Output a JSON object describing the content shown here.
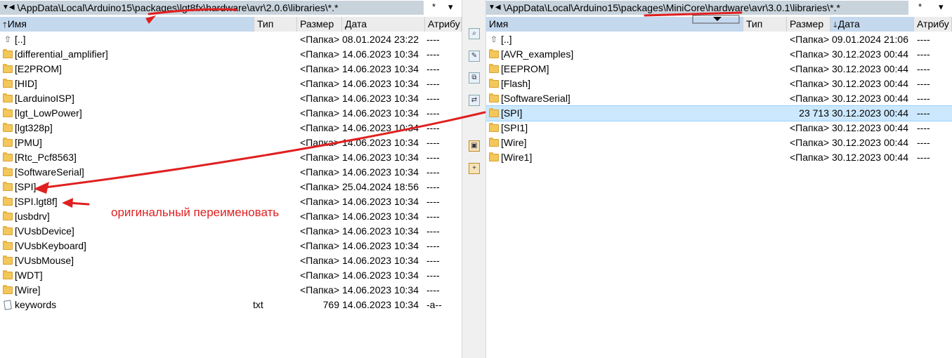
{
  "left_panel": {
    "path": "\\AppData\\Local\\Arduino15\\packages\\lgt8fx\\hardware\\avr\\2.0.6\\libraries\\*.*",
    "filter": "*",
    "filter_arrow": "▾",
    "columns": {
      "name": "Имя",
      "ext": "Тип",
      "size": "Размер",
      "date": "Дата",
      "attr": "Атрибу"
    },
    "rows": [
      {
        "icon": "up",
        "name": "[..]",
        "ext": "",
        "size": "<Папка>",
        "date": "08.01.2024 23:22",
        "attr": "----"
      },
      {
        "icon": "folder",
        "name": "[differential_amplifier]",
        "ext": "",
        "size": "<Папка>",
        "date": "14.06.2023 10:34",
        "attr": "----"
      },
      {
        "icon": "folder",
        "name": "[E2PROM]",
        "ext": "",
        "size": "<Папка>",
        "date": "14.06.2023 10:34",
        "attr": "----"
      },
      {
        "icon": "folder",
        "name": "[HID]",
        "ext": "",
        "size": "<Папка>",
        "date": "14.06.2023 10:34",
        "attr": "----"
      },
      {
        "icon": "folder",
        "name": "[LarduinoISP]",
        "ext": "",
        "size": "<Папка>",
        "date": "14.06.2023 10:34",
        "attr": "----"
      },
      {
        "icon": "folder",
        "name": "[lgt_LowPower]",
        "ext": "",
        "size": "<Папка>",
        "date": "14.06.2023 10:34",
        "attr": "----"
      },
      {
        "icon": "folder",
        "name": "[lgt328p]",
        "ext": "",
        "size": "<Папка>",
        "date": "14.06.2023 10:34",
        "attr": "----"
      },
      {
        "icon": "folder",
        "name": "[PMU]",
        "ext": "",
        "size": "<Папка>",
        "date": "14.06.2023 10:34",
        "attr": "----"
      },
      {
        "icon": "folder",
        "name": "[Rtc_Pcf8563]",
        "ext": "",
        "size": "<Папка>",
        "date": "14.06.2023 10:34",
        "attr": "----"
      },
      {
        "icon": "folder",
        "name": "[SoftwareSerial]",
        "ext": "",
        "size": "<Папка>",
        "date": "14.06.2023 10:34",
        "attr": "----"
      },
      {
        "icon": "folder",
        "name": "[SPI]",
        "ext": "",
        "size": "<Папка>",
        "date": "25.04.2024 18:56",
        "attr": "----"
      },
      {
        "icon": "folder",
        "name": "[SPI.lgt8f]",
        "ext": "",
        "size": "<Папка>",
        "date": "14.06.2023 10:34",
        "attr": "----"
      },
      {
        "icon": "folder",
        "name": "[usbdrv]",
        "ext": "",
        "size": "<Папка>",
        "date": "14.06.2023 10:34",
        "attr": "----"
      },
      {
        "icon": "folder",
        "name": "[VUsbDevice]",
        "ext": "",
        "size": "<Папка>",
        "date": "14.06.2023 10:34",
        "attr": "----"
      },
      {
        "icon": "folder",
        "name": "[VUsbKeyboard]",
        "ext": "",
        "size": "<Папка>",
        "date": "14.06.2023 10:34",
        "attr": "----"
      },
      {
        "icon": "folder",
        "name": "[VUsbMouse]",
        "ext": "",
        "size": "<Папка>",
        "date": "14.06.2023 10:34",
        "attr": "----"
      },
      {
        "icon": "folder",
        "name": "[WDT]",
        "ext": "",
        "size": "<Папка>",
        "date": "14.06.2023 10:34",
        "attr": "----"
      },
      {
        "icon": "folder",
        "name": "[Wire]",
        "ext": "",
        "size": "<Папка>",
        "date": "14.06.2023 10:34",
        "attr": "----"
      },
      {
        "icon": "file",
        "name": "keywords",
        "ext": "txt",
        "size": "769",
        "date": "14.06.2023 10:34",
        "attr": "-a--"
      }
    ]
  },
  "right_panel": {
    "path": "\\AppData\\Local\\Arduino15\\packages\\MiniCore\\hardware\\avr\\3.0.1\\libraries\\*.*",
    "filter": "*",
    "filter_arrow": "▾",
    "columns": {
      "name": "Имя",
      "ext": "Тип",
      "size": "Размер",
      "date": "Дата",
      "attr": "Атрибу"
    },
    "rows": [
      {
        "icon": "up",
        "name": "[..]",
        "ext": "",
        "size": "<Папка>",
        "date": "09.01.2024 21:06",
        "attr": "----"
      },
      {
        "icon": "folder",
        "name": "[AVR_examples]",
        "ext": "",
        "size": "<Папка>",
        "date": "30.12.2023 00:44",
        "attr": "----"
      },
      {
        "icon": "folder",
        "name": "[EEPROM]",
        "ext": "",
        "size": "<Папка>",
        "date": "30.12.2023 00:44",
        "attr": "----"
      },
      {
        "icon": "folder",
        "name": "[Flash]",
        "ext": "",
        "size": "<Папка>",
        "date": "30.12.2023 00:44",
        "attr": "----"
      },
      {
        "icon": "folder",
        "name": "[SoftwareSerial]",
        "ext": "",
        "size": "<Папка>",
        "date": "30.12.2023 00:44",
        "attr": "----"
      },
      {
        "icon": "folder",
        "name": "[SPI]",
        "ext": "",
        "size": "23 713",
        "date": "30.12.2023 00:44",
        "attr": "----",
        "selected": true
      },
      {
        "icon": "folder",
        "name": "[SPI1]",
        "ext": "",
        "size": "<Папка>",
        "date": "30.12.2023 00:44",
        "attr": "----"
      },
      {
        "icon": "folder",
        "name": "[Wire]",
        "ext": "",
        "size": "<Папка>",
        "date": "30.12.2023 00:44",
        "attr": "----"
      },
      {
        "icon": "folder",
        "name": "[Wire1]",
        "ext": "",
        "size": "<Папка>",
        "date": "30.12.2023 00:44",
        "attr": "----"
      }
    ]
  },
  "annotation": {
    "text": "оригинальный переименовать",
    "color": "#e02020"
  },
  "colors": {
    "path_bar": "#c8d3dc",
    "header_sorted": "#c5d9ee",
    "selection": "#cce8ff",
    "folder": "#f3c75a",
    "annotation": "#e02020"
  }
}
